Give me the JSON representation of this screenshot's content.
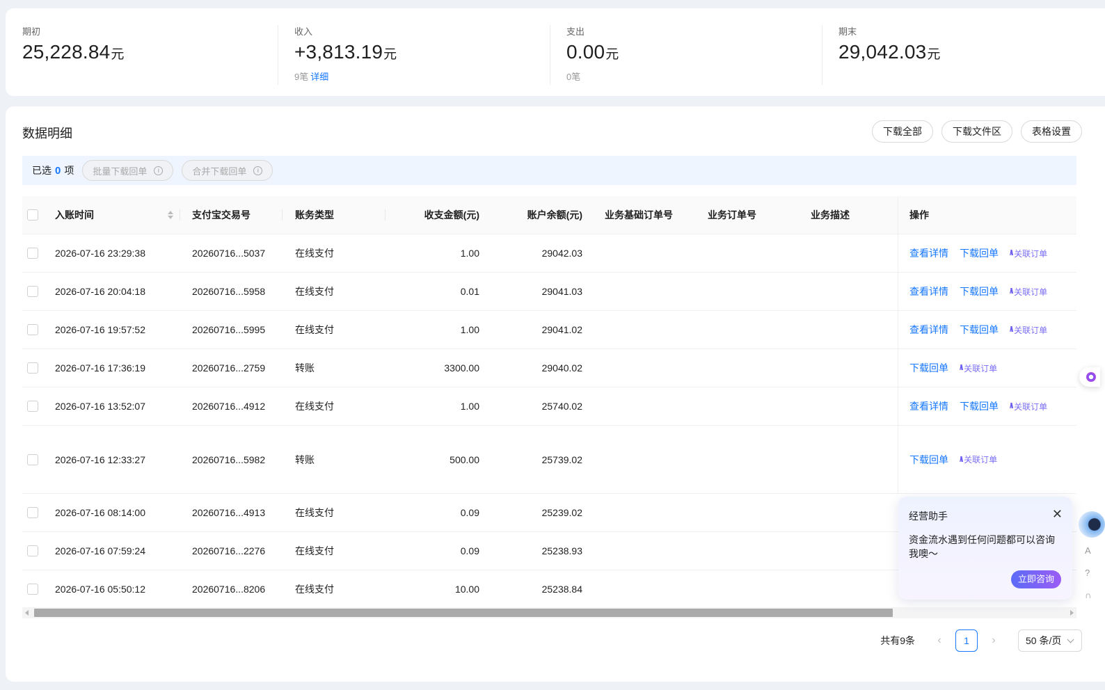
{
  "summary": [
    {
      "label": "期初",
      "value": "25,228.84",
      "unit": "元",
      "sub": "",
      "link": ""
    },
    {
      "label": "收入",
      "value": "+3,813.19",
      "unit": "元",
      "sub": "9笔",
      "link": "详细"
    },
    {
      "label": "支出",
      "value": "0.00",
      "unit": "元",
      "sub": "0笔",
      "link": ""
    },
    {
      "label": "期末",
      "value": "29,042.03",
      "unit": "元",
      "sub": "",
      "link": ""
    }
  ],
  "main": {
    "title": "数据明细",
    "buttons": [
      "下载全部",
      "下载文件区",
      "表格设置"
    ]
  },
  "selection": {
    "prefix": "已选",
    "count": "0",
    "suffix": "项",
    "batch_download": "批量下载回单",
    "merge_download": "合并下载回单"
  },
  "table": {
    "headers": [
      "入账时间",
      "支付宝交易号",
      "账务类型",
      "收支金额(元)",
      "账户余额(元)",
      "业务基础订单号",
      "业务订单号",
      "业务描述",
      "操作"
    ],
    "rows": [
      {
        "time": "2026-07-16 23:29:38",
        "trade_no": "20260716...5037",
        "type": "在线支付",
        "amount": "1.00",
        "balance": "29042.03",
        "ops": [
          "查看详情",
          "下载回单",
          "关联订单"
        ]
      },
      {
        "time": "2026-07-16 20:04:18",
        "trade_no": "20260716...5958",
        "type": "在线支付",
        "amount": "0.01",
        "balance": "29041.03",
        "ops": [
          "查看详情",
          "下载回单",
          "关联订单"
        ]
      },
      {
        "time": "2026-07-16 19:57:52",
        "trade_no": "20260716...5995",
        "type": "在线支付",
        "amount": "1.00",
        "balance": "29041.02",
        "ops": [
          "查看详情",
          "下载回单",
          "关联订单"
        ]
      },
      {
        "time": "2026-07-16 17:36:19",
        "trade_no": "20260716...2759",
        "type": "转账",
        "amount": "3300.00",
        "balance": "29040.02",
        "ops": [
          "下载回单",
          "关联订单"
        ]
      },
      {
        "time": "2026-07-16 13:52:07",
        "trade_no": "20260716...4912",
        "type": "在线支付",
        "amount": "1.00",
        "balance": "25740.02",
        "ops": [
          "查看详情",
          "下载回单",
          "关联订单"
        ]
      },
      {
        "time": "2026-07-16 12:33:27",
        "trade_no": "20260716...5982",
        "type": "转账",
        "amount": "500.00",
        "balance": "25739.02",
        "ops": [
          "下载回单",
          "关联订单"
        ]
      },
      {
        "time": "2026-07-16 08:14:00",
        "trade_no": "20260716...4913",
        "type": "在线支付",
        "amount": "0.09",
        "balance": "25239.02",
        "ops": []
      },
      {
        "time": "2026-07-16 07:59:24",
        "trade_no": "20260716...2276",
        "type": "在线支付",
        "amount": "0.09",
        "balance": "25238.93",
        "ops": []
      },
      {
        "time": "2026-07-16 05:50:12",
        "trade_no": "20260716...8206",
        "type": "在线支付",
        "amount": "10.00",
        "balance": "25238.84",
        "ops": []
      }
    ]
  },
  "pagination": {
    "total": "共有9条",
    "current_page": "1",
    "page_size": "50 条/页"
  },
  "assistant": {
    "title": "经营助手",
    "message": "资金流水遇到任何问题都可以咨询我噢～",
    "button": "立即咨询"
  },
  "icons": {
    "info": "info-icon",
    "sort": "sort-icon",
    "close": "close-icon",
    "ai": "ai-spark-icon"
  },
  "colors": {
    "accent": "#1677ff",
    "ai": "#7b6ef6",
    "selection_bar": "#eef5ff"
  }
}
